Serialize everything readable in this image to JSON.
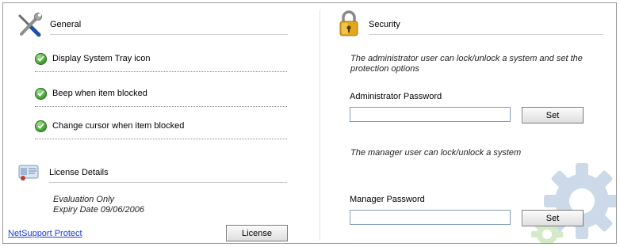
{
  "general": {
    "title": "General",
    "icon": "tools-icon",
    "options": [
      {
        "label": "Display System Tray icon",
        "checked": true
      },
      {
        "label": "Beep when item blocked",
        "checked": true
      },
      {
        "label": "Change cursor when item blocked",
        "checked": true
      }
    ]
  },
  "license": {
    "title": "License Details",
    "icon": "license-card-icon",
    "line1": "Evaluation Only",
    "line2": "Expiry Date 09/06/2006",
    "link_label": "NetSupport Protect",
    "button_label": "License"
  },
  "security": {
    "title": "Security",
    "icon": "padlock-icon",
    "admin_desc": "The administrator user can lock/unlock a system and set the protection options",
    "admin_label": "Administrator Password",
    "admin_value": "",
    "admin_set_label": "Set",
    "manager_desc": "The manager user can lock/unlock a system",
    "manager_label": "Manager Password",
    "manager_value": "",
    "manager_set_label": "Set"
  },
  "colors": {
    "check_green": "#3f9e2e",
    "link_blue": "#1a3fd3",
    "lock_gold": "#e0a81c"
  }
}
